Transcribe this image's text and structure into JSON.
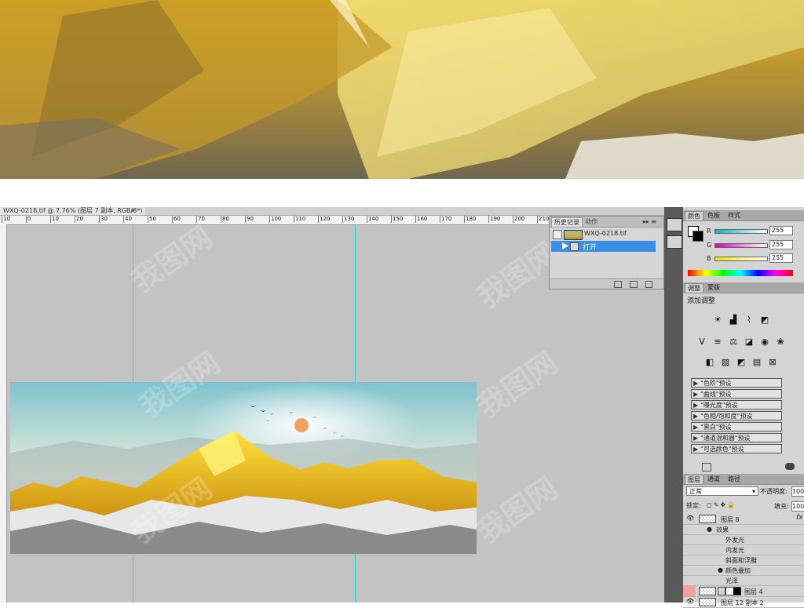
{
  "document": {
    "tab_title": "WXQ-0218.tif @ 7.76% (图层 7 副本, RGB/8*)",
    "close_glyph": "×",
    "ruler_ticks": [
      "10",
      "0",
      "10",
      "20",
      "30",
      "40",
      "50",
      "60",
      "70",
      "80",
      "90",
      "100",
      "110",
      "120",
      "130",
      "140",
      "150",
      "160",
      "170",
      "180",
      "190",
      "200",
      "210"
    ]
  },
  "history_panel": {
    "tabs": [
      "历史记录",
      "动作"
    ],
    "controls": "▸▸ ≡",
    "snapshot_name": "WXQ-0218.tif",
    "steps": [
      "打开"
    ]
  },
  "color_panel": {
    "tabs": [
      "颜色",
      "色板",
      "样式"
    ],
    "channels": [
      {
        "label": "R",
        "value": "255",
        "color": "#00b7c7"
      },
      {
        "label": "G",
        "value": "255",
        "color": "#d800c8"
      },
      {
        "label": "B",
        "value": "255",
        "color": "#e8e800"
      }
    ]
  },
  "adjustments_panel": {
    "tabs": [
      "调整",
      "蒙版"
    ],
    "header": "添加调整",
    "icons_row1": [
      "brightness-icon",
      "levels-icon",
      "curves-icon",
      "exposure-icon"
    ],
    "icons_row2": [
      "vibrance-icon",
      "hue-saturation-icon",
      "color-balance-icon",
      "black-white-icon",
      "photo-filter-icon",
      "channel-mixer-icon"
    ],
    "icons_row3": [
      "invert-icon",
      "posterize-icon",
      "threshold-icon",
      "gradient-map-icon",
      "selective-color-icon"
    ],
    "presets": [
      "\"色阶\"预设",
      "\"曲线\"预设",
      "\"曝光度\"预设",
      "\"色相/饱和度\"预设",
      "\"黑白\"预设",
      "\"通道混和器\"预设",
      "\"可选颜色\"预设"
    ]
  },
  "layers_panel": {
    "tabs": [
      "图层",
      "通道",
      "路径"
    ],
    "blend_mode": "正常",
    "opacity_label": "不透明度:",
    "opacity_value": "100",
    "lock_label": "锁定:",
    "fill_label": "填充:",
    "fill_value": "100",
    "fx_label": "fx",
    "layers": [
      {
        "name": "图层 8",
        "type": "layer"
      },
      {
        "name": "效果",
        "type": "effects-header"
      },
      {
        "name": "外发光",
        "type": "effect"
      },
      {
        "name": "内发光",
        "type": "effect"
      },
      {
        "name": "斜面和浮雕",
        "type": "effect"
      },
      {
        "name": "颜色叠加",
        "type": "effect"
      },
      {
        "name": "光泽",
        "type": "effect"
      },
      {
        "name": "图层 4",
        "type": "layer"
      },
      {
        "name": "图层 12 副本 2",
        "type": "layer"
      }
    ]
  },
  "watermark_text": "我图网",
  "colors": {
    "canvas_bg": "#c3c3c3",
    "guide": "#33d6d6",
    "selection": "#3a8ee6",
    "panel_bg": "#d4d4d4"
  }
}
